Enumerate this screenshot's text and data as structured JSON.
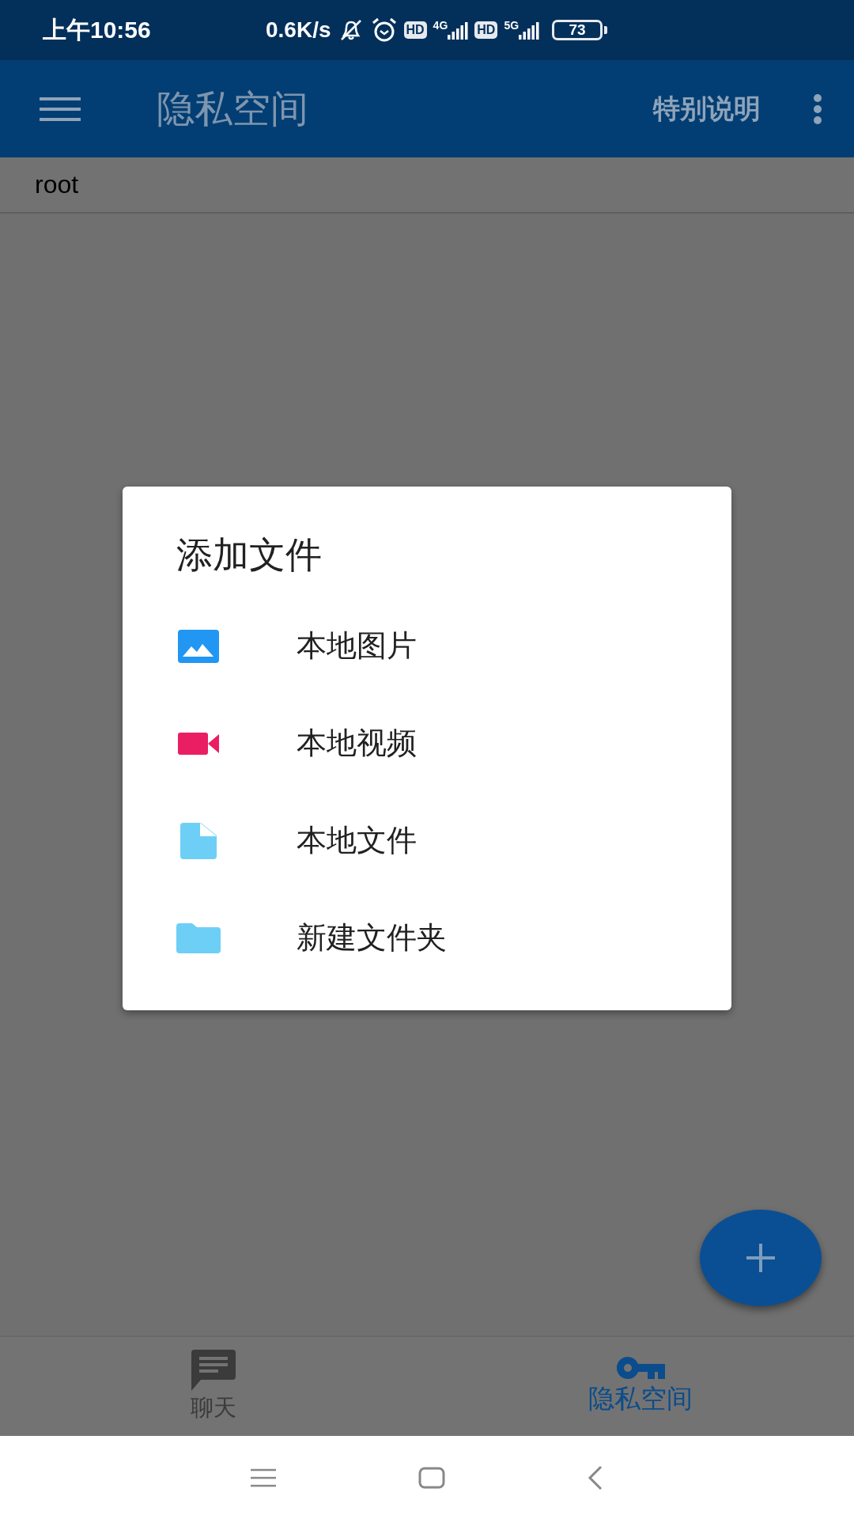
{
  "status_bar": {
    "time": "上午10:56",
    "net_speed": "0.6K/s",
    "sim1_badge": "HD",
    "sim1_network": "4G",
    "sim2_badge": "HD",
    "sim2_network": "5G",
    "battery": "73"
  },
  "app_bar": {
    "title": "隐私空间",
    "action": "特别说明"
  },
  "path": "root",
  "dialog": {
    "title": "添加文件",
    "items": [
      {
        "label": "本地图片",
        "kind": "image"
      },
      {
        "label": "本地视频",
        "kind": "video"
      },
      {
        "label": "本地文件",
        "kind": "file"
      },
      {
        "label": "新建文件夹",
        "kind": "folder"
      }
    ]
  },
  "bottom_nav": [
    {
      "label": "聊天",
      "kind": "chat",
      "selected": false
    },
    {
      "label": "隐私空间",
      "kind": "key",
      "selected": true
    }
  ]
}
